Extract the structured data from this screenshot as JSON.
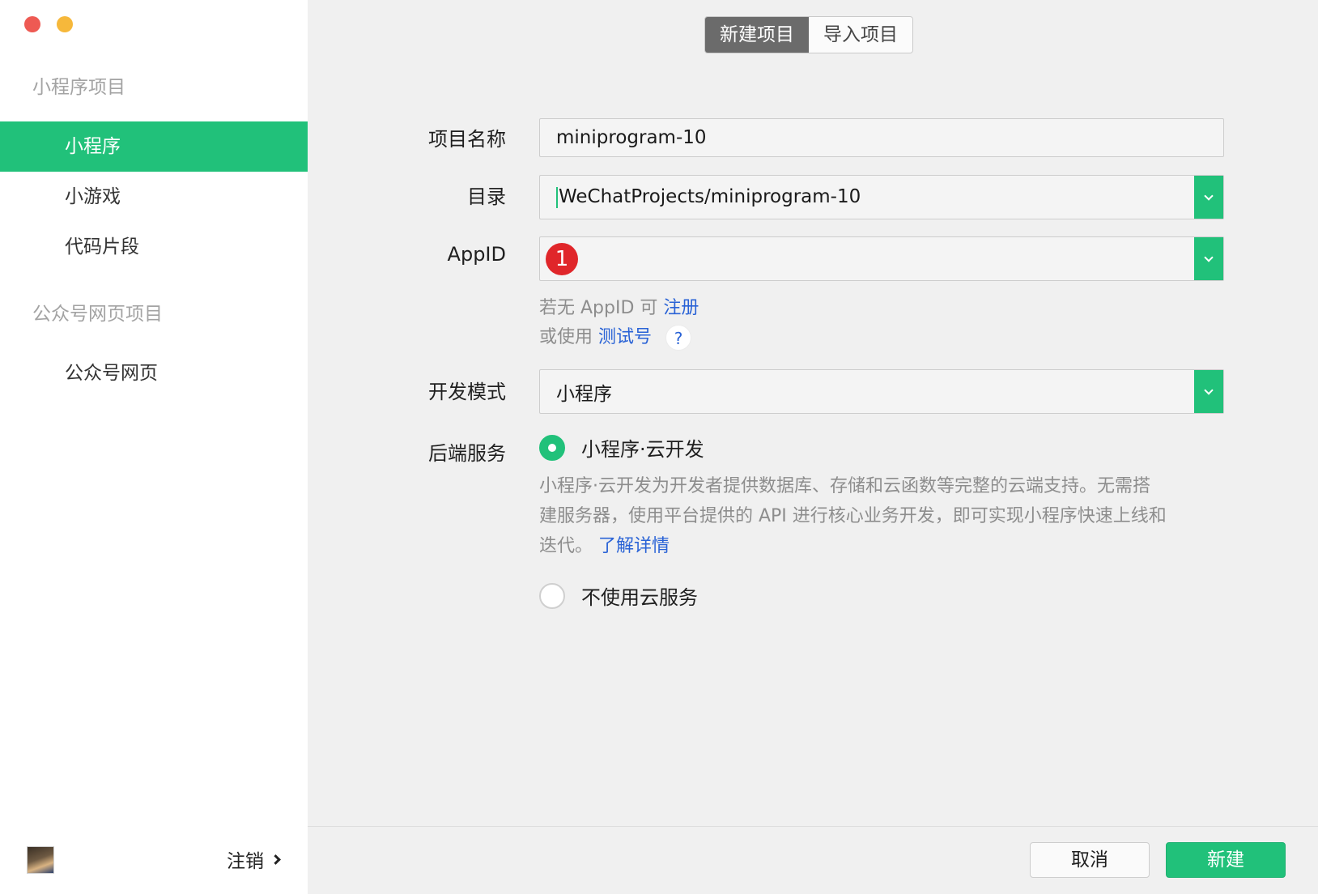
{
  "sidebar": {
    "groups": [
      {
        "title": "小程序项目",
        "items": [
          "小程序",
          "小游戏",
          "代码片段"
        ]
      },
      {
        "title": "公众号网页项目",
        "items": [
          "公众号网页"
        ]
      }
    ],
    "active_item": "小程序",
    "logout_label": "注销"
  },
  "tabs": {
    "new_project": "新建项目",
    "import_project": "导入项目"
  },
  "form": {
    "project_name": {
      "label": "项目名称",
      "value": "miniprogram-10"
    },
    "directory": {
      "label": "目录",
      "value": "WeChatProjects/miniprogram-10"
    },
    "appid": {
      "label": "AppID",
      "badge": "1",
      "hint_prefix": "若无 AppID 可",
      "hint_link": "注册",
      "hint2_prefix": "或使用",
      "hint2_link": "测试号",
      "help": "?"
    },
    "dev_mode": {
      "label": "开发模式",
      "value": "小程序"
    },
    "backend": {
      "label": "后端服务",
      "option_cloud": "小程序·云开发",
      "description_line1": "小程序·云开发为开发者提供数据库、存储和云函数等完整的云端支持。无需搭",
      "description_line2": "建服务器，使用平台提供的 API 进行核心业务开发，即可实现小程序快速上线和",
      "description_line3": "迭代。",
      "learn_more": "了解详情",
      "option_none": "不使用云服务",
      "selected": "cloud"
    }
  },
  "footer": {
    "cancel_label": "取消",
    "create_label": "新建"
  },
  "colors": {
    "accent": "#21c17a",
    "link": "#2a63d6",
    "badge": "#e0262a"
  }
}
